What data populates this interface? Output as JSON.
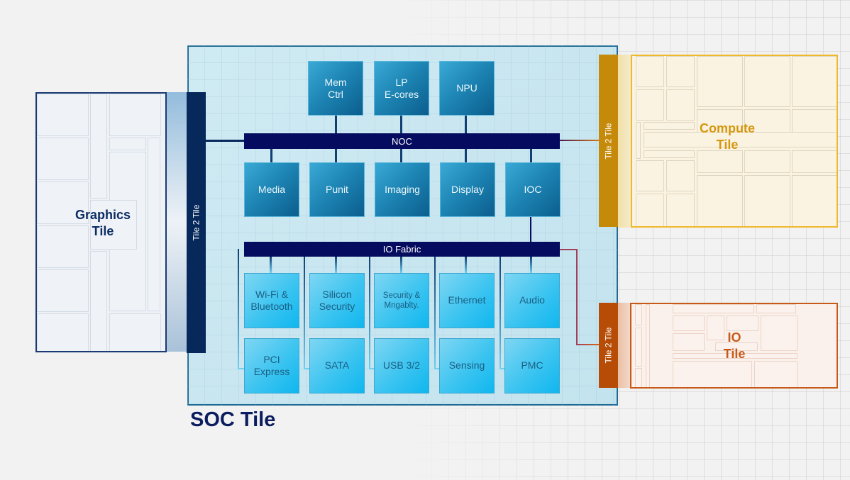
{
  "diagram": {
    "soc_tile": {
      "label": "SOC Tile",
      "noc_label": "NOC",
      "io_fabric_label": "IO Fabric",
      "top_blocks": [
        {
          "id": "mem-ctrl",
          "label": "Mem\nCtrl"
        },
        {
          "id": "lp-e-cores",
          "label": "LP\nE-cores"
        },
        {
          "id": "npu",
          "label": "NPU"
        }
      ],
      "noc_blocks": [
        {
          "id": "media",
          "label": "Media"
        },
        {
          "id": "punit",
          "label": "Punit"
        },
        {
          "id": "imaging",
          "label": "Imaging"
        },
        {
          "id": "display",
          "label": "Display"
        },
        {
          "id": "ioc",
          "label": "IOC"
        }
      ],
      "io_blocks_row1": [
        {
          "id": "wifi-bluetooth",
          "label": "Wi-Fi &\nBluetooth"
        },
        {
          "id": "silicon-security",
          "label": "Silicon\nSecurity"
        },
        {
          "id": "security-mngablty",
          "label": "Security &\nMngablty."
        },
        {
          "id": "ethernet",
          "label": "Ethernet"
        },
        {
          "id": "audio",
          "label": "Audio"
        }
      ],
      "io_blocks_row2": [
        {
          "id": "pci-express",
          "label": "PCI\nExpress"
        },
        {
          "id": "sata",
          "label": "SATA"
        },
        {
          "id": "usb",
          "label": "USB 3/2"
        },
        {
          "id": "sensing",
          "label": "Sensing"
        },
        {
          "id": "pmc",
          "label": "PMC"
        }
      ]
    },
    "graphics_tile": {
      "label": "Graphics\nTile",
      "t2t_label": "Tile 2 Tile"
    },
    "compute_tile": {
      "label": "Compute\nTile",
      "t2t_label": "Tile 2 Tile",
      "color": "#d4970f"
    },
    "io_tile": {
      "label": "IO\nTile",
      "t2t_label": "Tile 2 Tile",
      "color": "#c65b19"
    },
    "colors": {
      "bus": "#050b5e",
      "soc_border": "#1f6a94",
      "graphics_border": "#1b3b72",
      "compute_border": "#f0b82b",
      "io_border": "#c65b19"
    }
  }
}
